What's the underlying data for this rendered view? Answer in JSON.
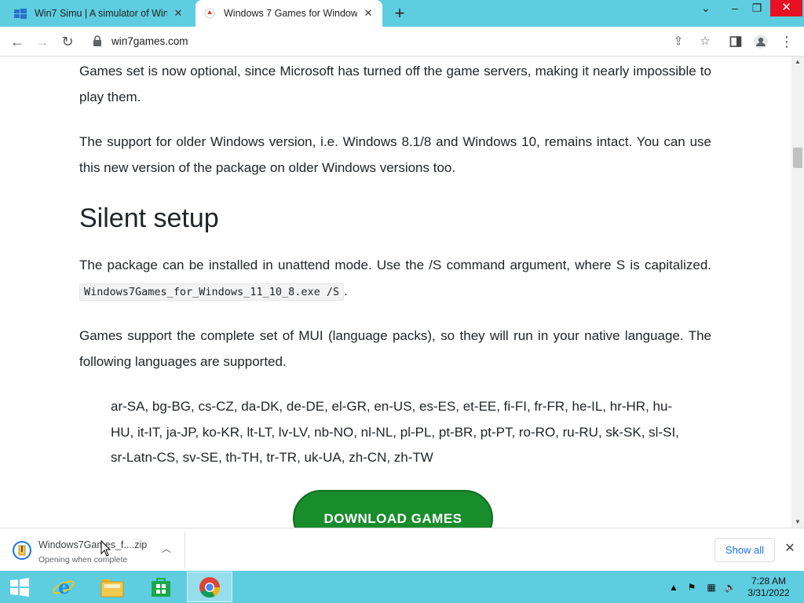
{
  "browser": {
    "tabs": [
      {
        "title": "Win7 Simu | A simulator of Windows",
        "active": false
      },
      {
        "title": "Windows 7 Games for Windows 11",
        "active": true
      }
    ],
    "new_tab": "+",
    "url": "win7games.com"
  },
  "article": {
    "p1": "Games set is now optional, since Microsoft has turned off the game servers, making it nearly impossible to play them.",
    "p2": "The support for older Windows version, i.e. Windows 8.1/8 and Windows 10, remains intact. You can use this new version of the package on older Windows versions too.",
    "heading": "Silent setup",
    "p3_text": "The package can be installed in unattend mode. Use the /S command argument, where S is capitalized.",
    "p3_code": "Windows7Games_for_Windows_11_10_8.exe /S",
    "p3_end": ".",
    "p4": "Games support the complete set of MUI (language packs), so they will run in your native language. The following languages are supported.",
    "languages": "ar-SA, bg-BG, cs-CZ, da-DK, de-DE, el-GR, en-US, es-ES, et-EE, fi-FI, fr-FR, he-IL, hr-HR, hu-HU, it-IT, ja-JP, ko-KR, lt-LT, lv-LV, nb-NO, nl-NL, pl-PL, pt-BR, pt-PT, ro-RO, ru-RU, sk-SK, sl-SI, sr-Latn-CS, sv-SE, th-TH, tr-TR, uk-UA, zh-CN, zh-TW",
    "download_button": "DOWNLOAD GAMES"
  },
  "download_shelf": {
    "file_name": "Windows7Games_f....zip",
    "status": "Opening when complete",
    "show_all": "Show all"
  },
  "taskbar": {
    "time": "7:28 AM",
    "date": "3/31/2022"
  },
  "colors": {
    "accent_cyan": "#5ecde0",
    "download_green": "#198c2c",
    "close_red": "#e81123"
  }
}
